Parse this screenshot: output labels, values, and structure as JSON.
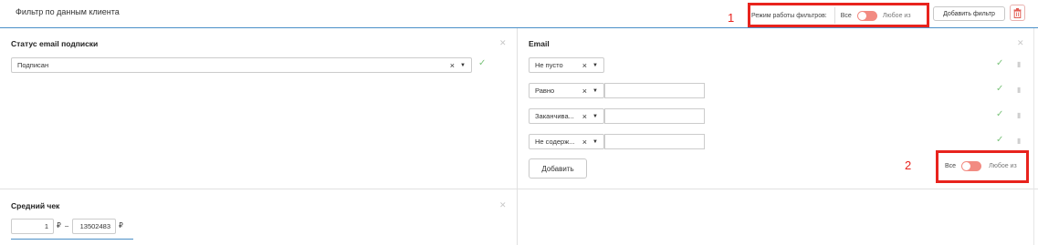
{
  "header": {
    "title": "Фильтр по данным клиента",
    "mode_label": "Режим работы фильтров:",
    "mode_all": "Все",
    "mode_any": "Любое из",
    "add_filter": "Добавить фильтр",
    "annotation_1": "1"
  },
  "email_status": {
    "title": "Статус email подписки",
    "value": "Подписан"
  },
  "email": {
    "title": "Email",
    "conditions": [
      {
        "operator": "Не пусто"
      },
      {
        "operator": "Равно",
        "value": ""
      },
      {
        "operator": "Заканчива...",
        "value": ""
      },
      {
        "operator": "Не содерж...",
        "value": ""
      }
    ],
    "add_label": "Добавить",
    "mode_all": "Все",
    "mode_any": "Любое из",
    "annotation_2": "2"
  },
  "avg_check": {
    "title": "Средний чек",
    "from": "1",
    "to": "13502483",
    "currency": "₽",
    "dash": "–"
  },
  "colors": {
    "accent": "#4a90c8",
    "annotation_red": "#e8231d",
    "toggle": "#f28b82",
    "check_green": "#7cc47c"
  }
}
